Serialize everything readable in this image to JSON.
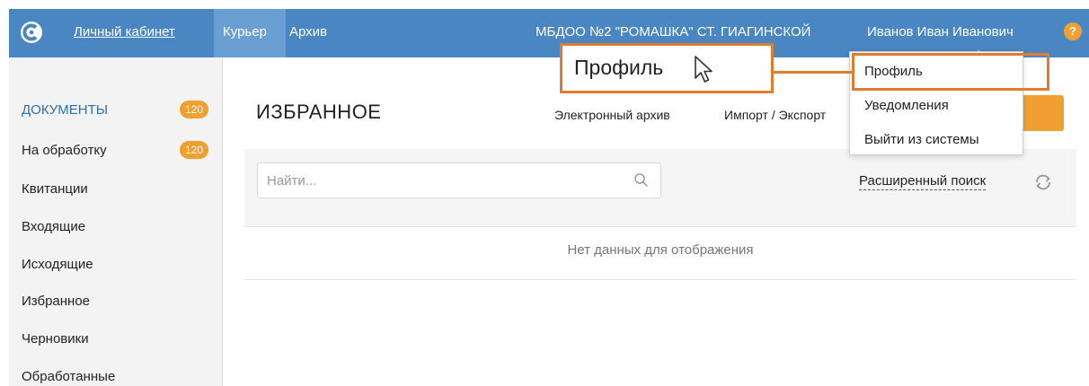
{
  "header": {
    "logo_icon": "app-logo-icon",
    "nav": [
      {
        "label": "Личный кабинет"
      },
      {
        "label": "Курьер"
      },
      {
        "label": "Архив"
      }
    ],
    "organization": "МБДОО №2 \"РОМАШКА\" СТ. ГИАГИНСКОЙ",
    "user": "Иванов Иван Иванович",
    "help": "?",
    "bar_color": "#4a86c2"
  },
  "sidebar": {
    "items": [
      {
        "label": "ДОКУМЕНТЫ",
        "badge": "120"
      },
      {
        "label": "На обработку",
        "badge": "120"
      },
      {
        "label": "Квитанции"
      },
      {
        "label": "Входящие"
      },
      {
        "label": "Исходящие"
      },
      {
        "label": "Избранное"
      },
      {
        "label": "Черновики"
      },
      {
        "label": "Обработанные"
      }
    ],
    "badge_color": "#f0a030"
  },
  "main": {
    "title": "ИЗБРАННОЕ",
    "links": [
      {
        "label": "Электронный архив"
      },
      {
        "label": "Импорт / Экспорт"
      }
    ],
    "search": {
      "placeholder": "Найти..."
    },
    "advanced_search": "Расширенный поиск",
    "empty_message": "Нет данных для отображения"
  },
  "user_menu": {
    "items": [
      {
        "label": "Профиль"
      },
      {
        "label": "Уведомления"
      },
      {
        "label": "Выйти из системы"
      }
    ]
  },
  "callout": {
    "label": "Профиль",
    "highlight_color": "#e07b30"
  }
}
